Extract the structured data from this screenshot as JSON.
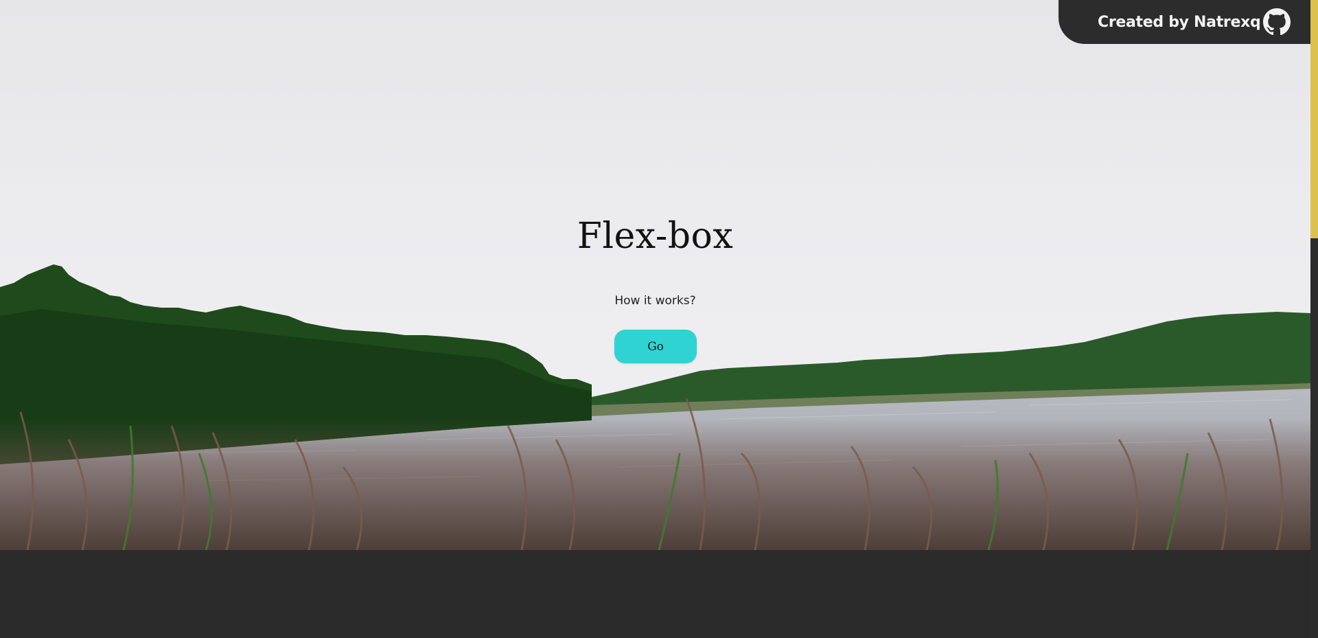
{
  "hero": {
    "title": "Flex-box",
    "subtitle": "How it works?",
    "button_label": "Go"
  },
  "credit": {
    "text": "Created by Natrexq",
    "icon": "github-icon"
  },
  "colors": {
    "accent_button": "#2fd3d1",
    "badge_background": "#2c2c2c",
    "scrollbar_thumb": "#dcc24a",
    "page_background": "#2b2b2b"
  }
}
